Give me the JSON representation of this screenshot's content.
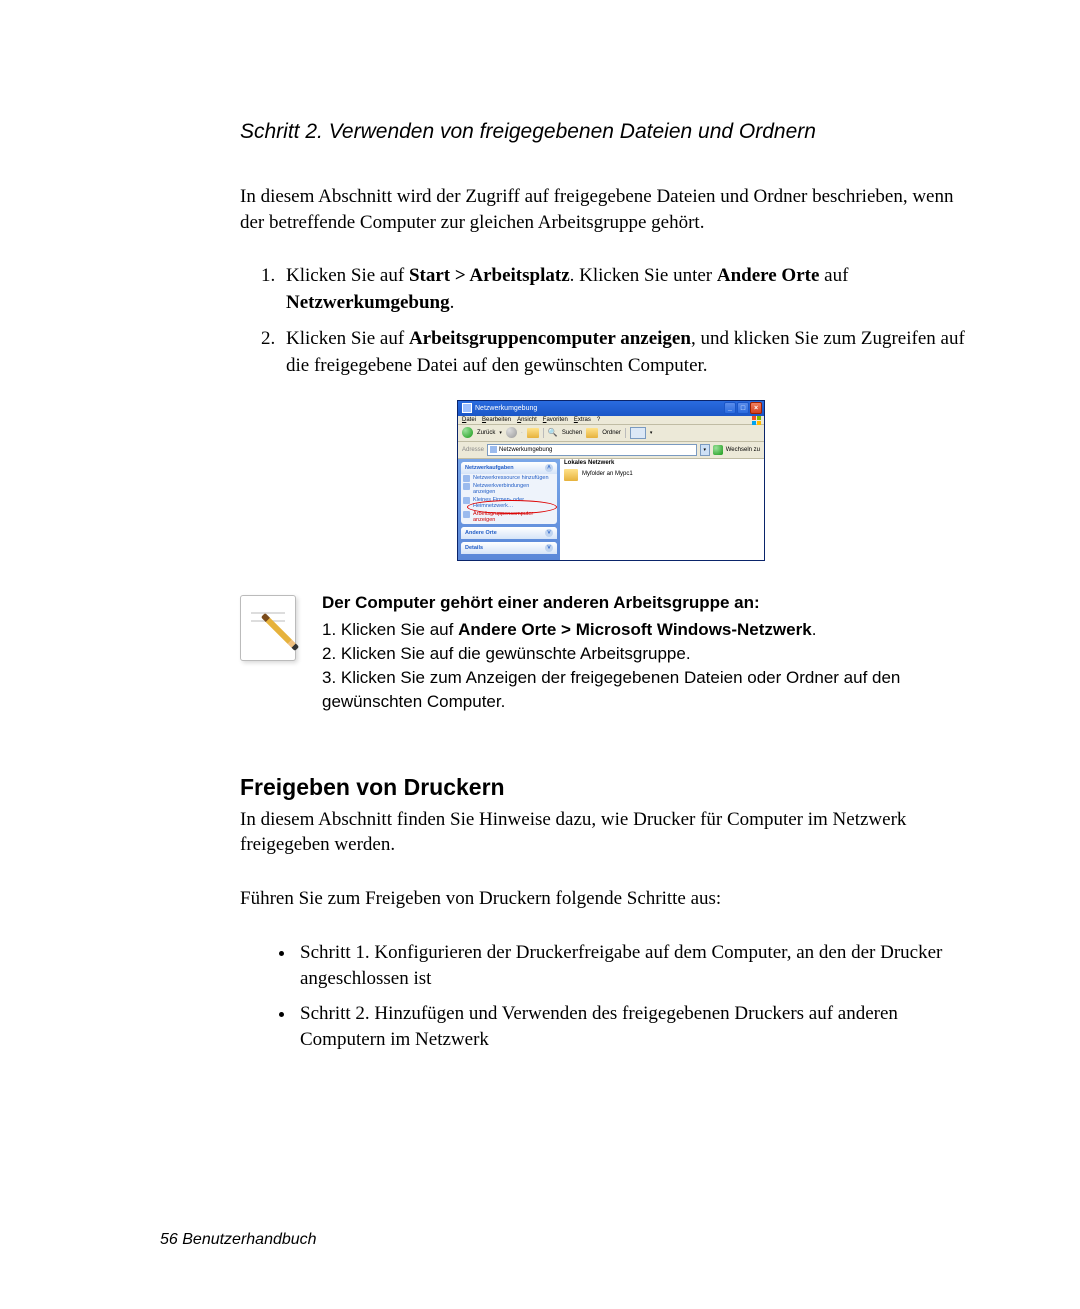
{
  "heading_step": "Schritt 2. Verwenden von freigegebenen Dateien und Ordnern",
  "intro": "In diesem Abschnitt wird der Zugriff auf freigegebene Dateien und Ordner beschrieben, wenn der betreffende Computer zur gleichen Arbeitsgruppe gehört.",
  "step1_pre": "Klicken Sie auf ",
  "step1_bold1": "Start > Arbeitsplatz",
  "step1_mid": ". Klicken Sie unter ",
  "step1_bold2": "Andere Orte",
  "step1_mid2": " auf ",
  "step1_bold3": "Netzwerkumgebung",
  "step1_end": ".",
  "step2_pre": "Klicken Sie auf ",
  "step2_bold1": "Arbeitsgruppencomputer anzeigen",
  "step2_end": ", und klicken Sie zum Zugreifen auf die freigegebene Datei auf den gewünschten Computer.",
  "xpwin": {
    "title": "Netzwerkumgebung",
    "menu": [
      "Datei",
      "Bearbeiten",
      "Ansicht",
      "Favoriten",
      "Extras",
      "?"
    ],
    "tb_back": "Zurück",
    "tb_search": "Suchen",
    "tb_folders": "Ordner",
    "addr_label": "Adresse",
    "addr_value": "Netzwerkumgebung",
    "addr_go": "Wechseln zu",
    "panel_tasks_hdr": "Netzwerkaufgaben",
    "panel_tasks_items": [
      "Netzwerkressource hinzufügen",
      "Netzwerkverbindungen anzeigen",
      "Kleines Firmen- oder Heimnetzwerk…",
      "Arbeitsgruppencomputer anzeigen"
    ],
    "panel_places_hdr": "Andere Orte",
    "panel_details_hdr": "Details",
    "main_header": "Lokales Netzwerk",
    "main_item": "Myfolder an Mypc1"
  },
  "note_title": "Der Computer gehört einer anderen Arbeitsgruppe an:",
  "note_l1a": "1. Klicken Sie auf ",
  "note_l1b": "Andere Orte > Microsoft Windows-Netzwerk",
  "note_l1c": ".",
  "note_l2": "2. Klicken Sie auf die gewünschte Arbeitsgruppe.",
  "note_l3": "3. Klicken Sie zum Anzeigen der freigegebenen Dateien oder Ordner auf den gewünschten Computer.",
  "section2_title": "Freigeben von Druckern",
  "section2_intro": "In diesem Abschnitt finden Sie Hinweise dazu, wie Drucker für Computer im Netzwerk freigegeben werden.",
  "section2_lead": "Führen Sie zum Freigeben von Druckern folgende Schritte aus:",
  "section2_b1": "Schritt 1. Konfigurieren der Druckerfreigabe auf dem Computer, an den der Drucker angeschlossen ist",
  "section2_b2": "Schritt 2. Hinzufügen und Verwenden des freigegebenen Druckers auf anderen Computern im Netzwerk",
  "footer": "56  Benutzerhandbuch"
}
